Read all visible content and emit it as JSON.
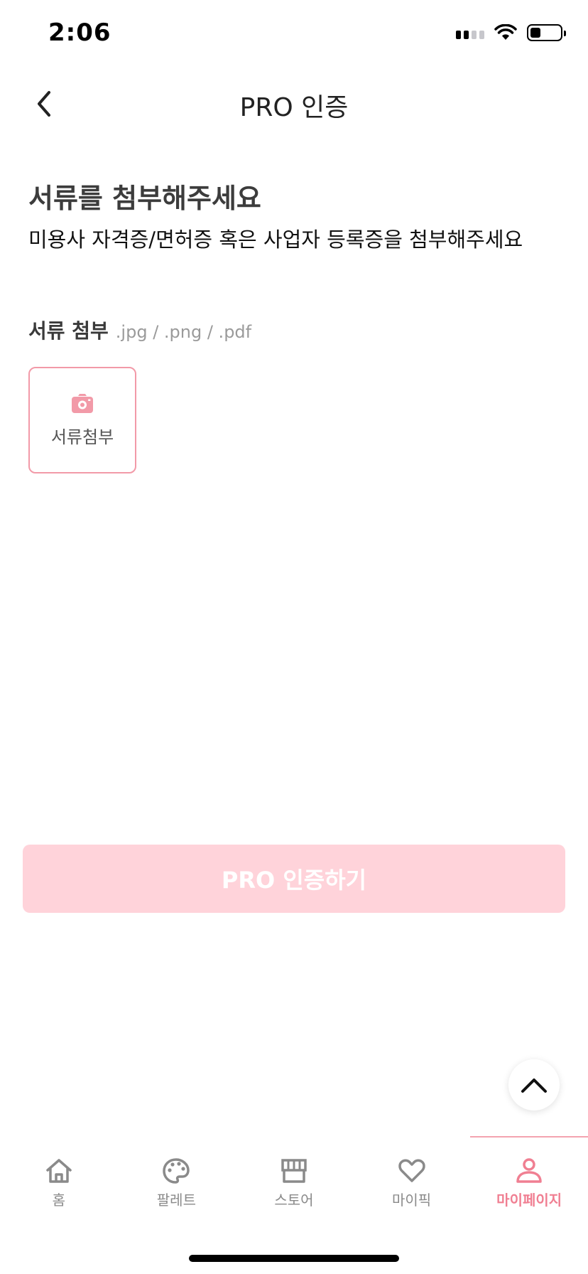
{
  "status_bar": {
    "time": "2:06"
  },
  "header": {
    "title": "PRO 인증"
  },
  "content": {
    "title": "서류를 첨부해주세요",
    "description": "미용사 자격증/면허증 혹은 사업자 등록증을 첨부해주세요",
    "attach_label": "서류 첨부",
    "attach_formats": ".jpg / .png / .pdf",
    "attach_box_label": "서류첨부"
  },
  "submit_label": "PRO 인증하기",
  "tabs": [
    {
      "label": "홈",
      "icon": "home-icon"
    },
    {
      "label": "팔레트",
      "icon": "palette-icon"
    },
    {
      "label": "스토어",
      "icon": "store-icon"
    },
    {
      "label": "마이픽",
      "icon": "heart-icon"
    },
    {
      "label": "마이페이지",
      "icon": "person-icon",
      "active": true
    }
  ],
  "colors": {
    "accent": "#f07f92",
    "submit_disabled": "#ffd3da",
    "attach_border": "#f29aa8"
  }
}
